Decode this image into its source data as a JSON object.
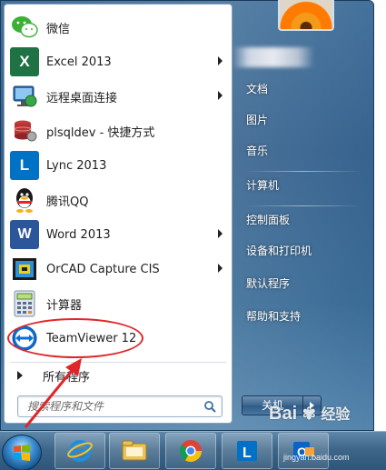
{
  "programs": [
    {
      "label": "微信",
      "icon": "wechat-icon",
      "has_submenu": false
    },
    {
      "label": "Excel 2013",
      "icon": "excel-icon",
      "has_submenu": true
    },
    {
      "label": "远程桌面连接",
      "icon": "remote-desktop-icon",
      "has_submenu": true
    },
    {
      "label": "plsqldev - 快捷方式",
      "icon": "plsqldev-icon",
      "has_submenu": false
    },
    {
      "label": "Lync 2013",
      "icon": "lync-icon",
      "has_submenu": false
    },
    {
      "label": "腾讯QQ",
      "icon": "qq-icon",
      "has_submenu": false
    },
    {
      "label": "Word 2013",
      "icon": "word-icon",
      "has_submenu": true
    },
    {
      "label": "OrCAD Capture CIS",
      "icon": "orcad-icon",
      "has_submenu": true
    },
    {
      "label": "计算器",
      "icon": "calculator-icon",
      "has_submenu": false
    },
    {
      "label": "TeamViewer 12",
      "icon": "teamviewer-icon",
      "has_submenu": false
    }
  ],
  "all_programs_label": "所有程序",
  "search": {
    "placeholder": "搜索程序和文件"
  },
  "right_items": [
    {
      "label": "文档"
    },
    {
      "label": "图片"
    },
    {
      "label": "音乐"
    },
    {
      "label": "计算机"
    },
    {
      "label": "控制面板"
    },
    {
      "label": "设备和打印机"
    },
    {
      "label": "默认程序"
    },
    {
      "label": "帮助和支持"
    }
  ],
  "shutdown_label": "关机",
  "taskbar": {
    "pinned": [
      "internet-explorer-icon",
      "file-explorer-icon",
      "chrome-icon",
      "lync-icon",
      "outlook-icon"
    ]
  },
  "watermark": {
    "brand": "Bai",
    "brand_suffix": "经验",
    "url": "jingyan.baidu.com"
  },
  "colors": {
    "annotation": "#e0262a",
    "excel": "#1f7244",
    "word": "#2b579a",
    "lync": "#0072c6"
  }
}
